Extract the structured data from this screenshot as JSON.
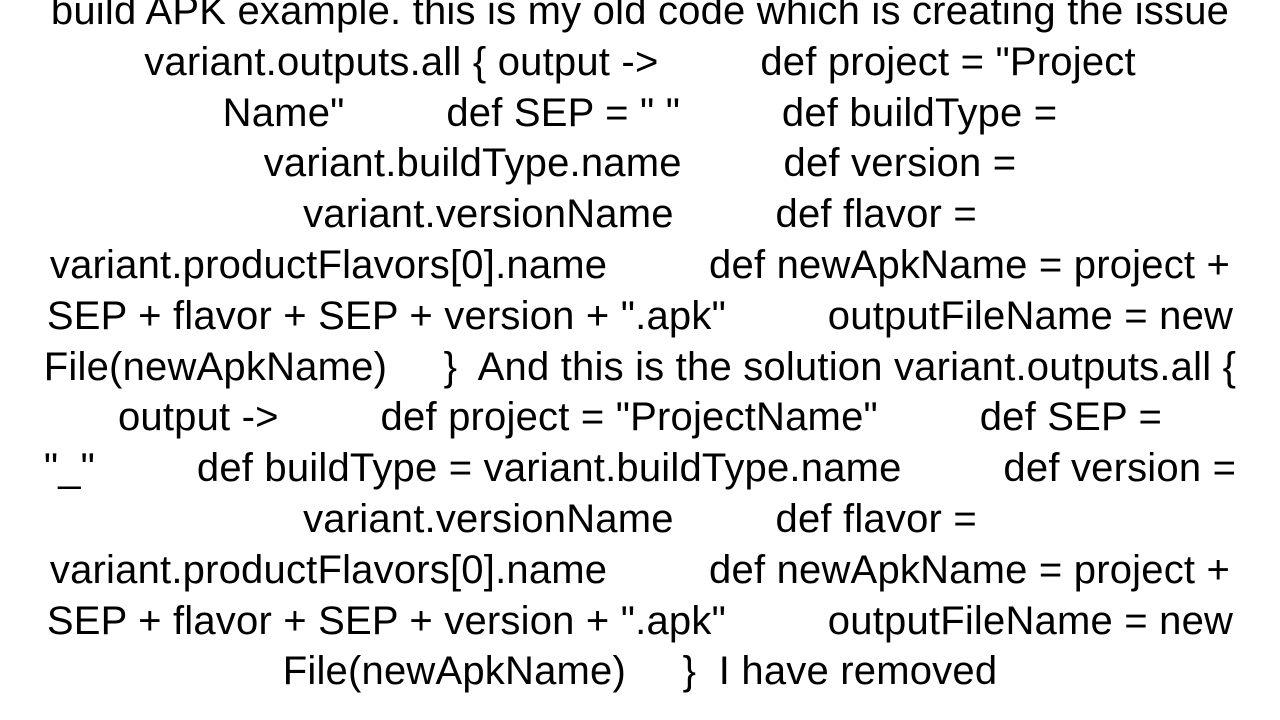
{
  "document": {
    "text": "build APK example. this is my old code which is creating the issue variant.outputs.all { output ->         def project = \"Project Name\"         def SEP = \" \"         def buildType = variant.buildType.name         def version = variant.versionName         def flavor = variant.productFlavors[0].name         def newApkName = project + SEP + flavor + SEP + version + \".apk\"         outputFileName = new File(newApkName)     }  And this is the solution variant.outputs.all { output ->         def project = \"ProjectName\"         def SEP = \"_\"         def buildType = variant.buildType.name         def version = variant.versionName         def flavor = variant.productFlavors[0].name         def newApkName = project + SEP + flavor + SEP + version + \".apk\"         outputFileName = new File(newApkName)     }  I have removed"
  }
}
